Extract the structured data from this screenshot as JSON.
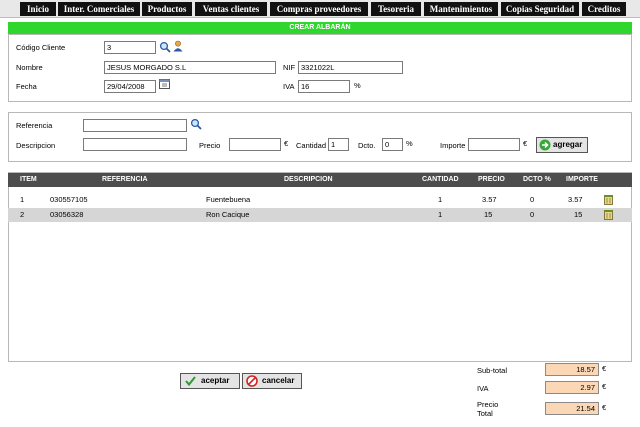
{
  "menu": [
    "Inicio",
    "Inter. Comerciales",
    "Productos",
    "Ventas clientes",
    "Compras proveedores",
    "Tesoreria",
    "Mantenimientos",
    "Copias Seguridad",
    "Creditos"
  ],
  "header": {
    "title": "CREAR ALBARÁN"
  },
  "customer": {
    "codigo_label": "Código Cliente",
    "codigo_value": "3",
    "nombre_label": "Nombre",
    "nombre_value": "JESUS MORGADO S.L",
    "nif_label": "NIF",
    "nif_value": "3321022L",
    "fecha_label": "Fecha",
    "fecha_value": "29/04/2008",
    "iva_label": "IVA",
    "iva_value": "16",
    "iva_unit": "%"
  },
  "line_entry": {
    "referencia_label": "Referencia",
    "referencia_value": "",
    "descripcion_label": "Descripcion",
    "descripcion_value": "",
    "precio_label": "Precio",
    "precio_value": "",
    "precio_unit": "€",
    "cantidad_label": "Cantidad",
    "cantidad_value": "1",
    "dcto_label": "Dcto.",
    "dcto_value": "0",
    "dcto_unit": "%",
    "importe_label": "Importe",
    "importe_value": "",
    "importe_unit": "€",
    "agregar_label": "agregar"
  },
  "table": {
    "columns": [
      "ITEM",
      "REFERENCIA",
      "DESCRIPCION",
      "CANTIDAD",
      "PRECIO",
      "DCTO %",
      "IMPORTE"
    ],
    "rows": [
      {
        "item": "1",
        "referencia": "030557105",
        "descripcion": "Fuentebuena",
        "cantidad": "1",
        "precio": "3.57",
        "dcto": "0",
        "importe": "3.57"
      },
      {
        "item": "2",
        "referencia": "03056328",
        "descripcion": "Ron Cacique",
        "cantidad": "1",
        "precio": "15",
        "dcto": "0",
        "importe": "15"
      }
    ]
  },
  "actions": {
    "aceptar": "aceptar",
    "cancelar": "cancelar"
  },
  "totals": {
    "subtotal_label": "Sub-total",
    "subtotal_value": "18.57",
    "iva_label": "IVA",
    "iva_value": "2.97",
    "precio_label_1": "Precio",
    "precio_label_2": "Total",
    "precio_value": "21.54",
    "currency": "€"
  },
  "colors": {
    "menu_bg": "#111111",
    "header_green": "#2ed62e",
    "table_head": "#4d4d4d",
    "row_alt": "#d6d6d6",
    "totals_bg": "#fbd7b5"
  }
}
